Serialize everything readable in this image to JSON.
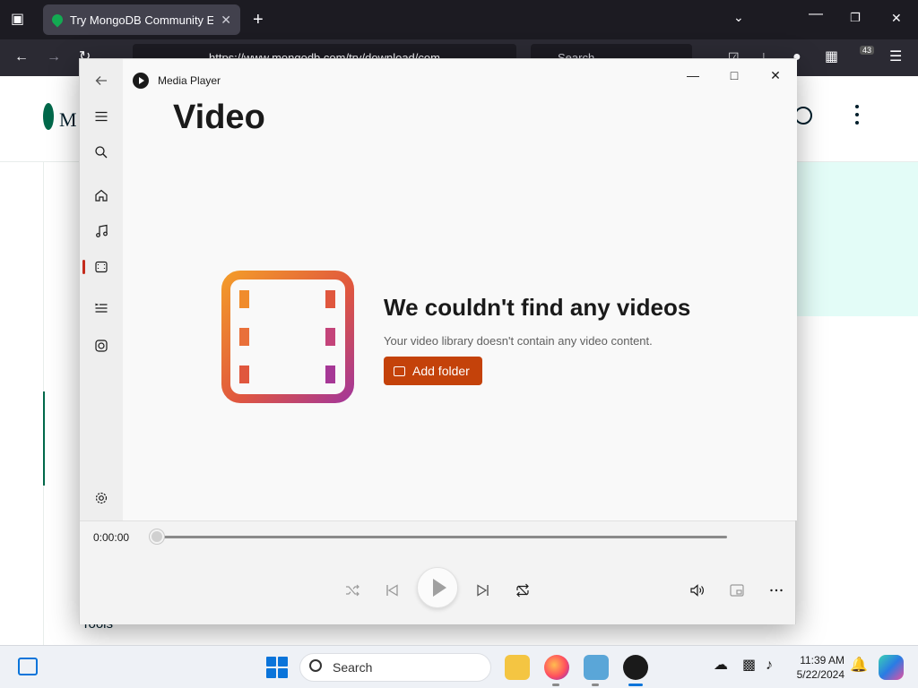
{
  "browser": {
    "tab_title": "Try MongoDB Community Editi",
    "url": "https://www.mongodb.com/try/download/com",
    "search_placeholder": "Search",
    "extensions_badge": "43"
  },
  "webpage": {
    "brand_initial": "M",
    "footer_link": "Tools",
    "accent_color": "#00684a"
  },
  "media_player": {
    "app_title": "Media Player",
    "heading": "Video",
    "empty_title": "We couldn't find any videos",
    "empty_subtitle": "Your video library doesn't contain any video content.",
    "add_folder_label": "Add folder",
    "accent_color": "#c4420a",
    "current_time": "0:00:00",
    "progress": 0,
    "nav": [
      "back-icon",
      "menu-icon",
      "search-icon",
      "home-icon",
      "music-icon",
      "video-icon",
      "playlist-icon",
      "playqueue-icon",
      "settings-icon"
    ],
    "active_nav": "video"
  },
  "taskbar": {
    "search_label": "Search",
    "time": "11:39 AM",
    "date": "5/22/2024"
  }
}
